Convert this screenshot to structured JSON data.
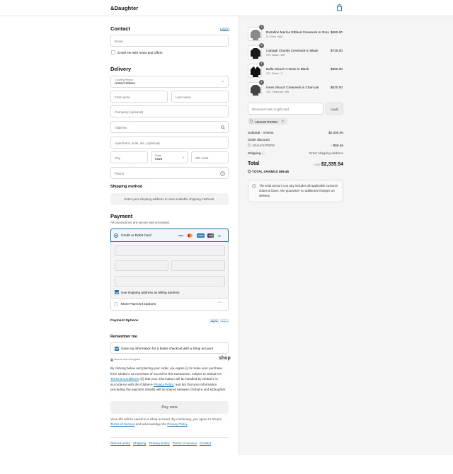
{
  "header": {
    "brand": "&Daughter",
    "cart_icon": "shopping-bag-icon"
  },
  "contact": {
    "title": "Contact",
    "login_label": "Log in",
    "email_placeholder": "Email",
    "newsletter_label": "Email me with news and offers",
    "newsletter_checked": false
  },
  "delivery": {
    "title": "Delivery",
    "country_label": "Country/Region",
    "country_value": "United States",
    "first_name_placeholder": "First name",
    "last_name_placeholder": "Last name",
    "company_placeholder": "Company (optional)",
    "address_placeholder": "Address",
    "apartment_placeholder": "Apartment, suite, etc. (optional)",
    "city_placeholder": "City",
    "state_label": "State",
    "state_value": "Iowa",
    "zip_placeholder": "ZIP code",
    "phone_placeholder": "Phone"
  },
  "shipping_method": {
    "title": "Shipping method",
    "notice": "Enter your shipping address to view available shipping methods."
  },
  "payment": {
    "title": "Payment",
    "subtitle": "All transactions are secure and encrypted.",
    "card_option_label": "Credit or Debit Card",
    "card_brands": [
      "VISA",
      "MC",
      "AMEX",
      "JCB"
    ],
    "more_cards": "+3",
    "billing_same_label": "Use shipping address as billing address",
    "billing_same_checked": true,
    "more_options_label": "More Payment Options"
  },
  "payment_options": {
    "title": "Payment Options",
    "badges": [
      "PayPal",
      "Venmo"
    ]
  },
  "remember_me": {
    "title": "Remember me",
    "save_label": "Save my information for a faster checkout with a Shop account",
    "save_checked": true,
    "secure_label": "Secure and encrypted",
    "shop_logo": "shop"
  },
  "legal": {
    "part1": "By clicking below and placing your order, you agree (i) to make your purchase from Global-e as merchant of record for this transaction, subject to Global-e's ",
    "terms_link": "Terms & Conditions",
    "part2": "; (ii) that your information will be handled by Global-e in accordance with the Global-e ",
    "privacy_link": "Privacy Policy",
    "part3": "; and (iii) that your information (excluding the payment details) will be shared between Global-e and &Daughter."
  },
  "pay_button": "Pay now",
  "shop_notice": {
    "part1": "Your info will be saved to a Shop account. By continuing, you agree to Shop's ",
    "terms_link": "Terms of Service",
    "part2": " and acknowledge the ",
    "privacy_link": "Privacy Policy",
    "part3": "."
  },
  "footer_links": [
    "Refund policy",
    "Shipping",
    "Privacy policy",
    "Terms of service",
    "Contact"
  ],
  "order": {
    "items": [
      {
        "qty": "1",
        "name": "Extrafine Merino Ribbed Crewneck in Grey",
        "variant": "S / Grey / AW",
        "price": "$580.00"
      },
      {
        "qty": "1",
        "name": "Cariagh Chunky Crewneck in Black",
        "variant": "XS / Black / AW",
        "price": "$725.00"
      },
      {
        "qty": "1",
        "name": "Balla Slouch V-Neck in Black",
        "variant": "XS / Black / C",
        "price": "$580.00"
      },
      {
        "qty": "1",
        "name": "Innes Slouch Crewneck in Charcoal",
        "variant": "XS / Charcoal / AW",
        "price": "$520.00"
      }
    ],
    "discount_placeholder": "Discount code or gift card",
    "apply_label": "Apply",
    "applied_code": "ADAUGHTER50",
    "subtotal_label": "Subtotal · 4 items",
    "subtotal_value": "$2,405.00",
    "order_discount_label": "Order discount",
    "discount_code": "ADAUGHTER50",
    "discount_value": "- $69.46",
    "shipping_label": "Shipping",
    "shipping_value": "Enter shipping address",
    "total_label": "Total",
    "currency": "USD",
    "total_value": "$2,335.54",
    "savings_label": "TOTAL SAVINGS",
    "savings_value": "$69.46",
    "info_text": "The total amount you pay includes all applicable customs duties & taxes. We guarantee no additional charges on delivery."
  },
  "colors": {
    "accent": "#1773b0",
    "summary_bg": "#f5f5f5",
    "pay_button_bg": "#f0f0f0"
  }
}
